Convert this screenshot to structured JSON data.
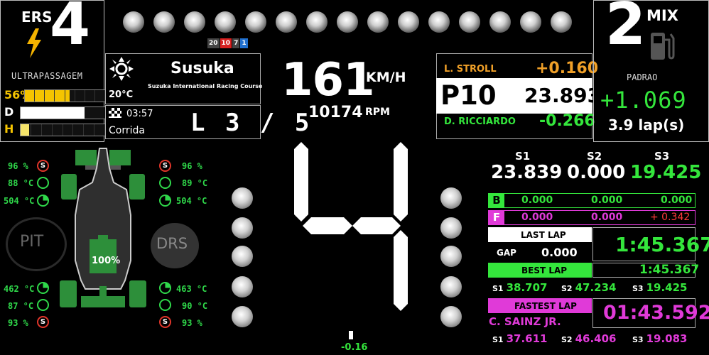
{
  "ers": {
    "label": "ERS",
    "mode": "4",
    "mode_name": "ULTRAPASSAGEM"
  },
  "bars": [
    {
      "label": "56%",
      "fill": 0.56,
      "color": "#f5c400",
      "label_color": "#f5c400"
    },
    {
      "label": "D",
      "fill": 0.76,
      "color": "#ffffff",
      "label_color": "#ffffff"
    },
    {
      "label": "H",
      "fill": 0.1,
      "color": "#f5e46a",
      "label_color": "#f5c400"
    }
  ],
  "track": {
    "name": "Susuka",
    "full_name": "Suzuka International Racing Course",
    "temp": "20°C",
    "session_time": "03:57",
    "session_type": "Corrida",
    "laps": "L 3 / 5"
  },
  "mini_lights": [
    "20",
    "10",
    "7",
    "1"
  ],
  "speed": {
    "value": "161",
    "unit": "KM/H"
  },
  "rpm": {
    "value": "10174",
    "unit": "RPM"
  },
  "position": {
    "ahead_name": "L. STROLL",
    "ahead_gap": "+0.160",
    "label": "P10",
    "time": "23.893",
    "behind_name": "D. RICCIARDO",
    "behind_gap": "-0.266"
  },
  "fuel": {
    "mode": "2",
    "label": "MIX",
    "mode_name": "PADRAO",
    "delta": "+1.069",
    "laps": "3.9 lap(s)"
  },
  "gear": "4",
  "tyres": {
    "fl": {
      "wear": "96 %",
      "temp": "88 °C",
      "brake": "504 °C"
    },
    "fr": {
      "wear": "96 %",
      "temp": "89 °C",
      "brake": "504 °C"
    },
    "rl": {
      "brake": "462 °C",
      "temp": "87 °C",
      "wear": "93 %"
    },
    "rr": {
      "brake": "463 °C",
      "temp": "90 °C",
      "wear": "93 %"
    }
  },
  "car": {
    "fuel_pct": "100%"
  },
  "pit": "PIT",
  "drs": "DRS",
  "sectors": {
    "heads": [
      "S1",
      "S2",
      "S3"
    ],
    "values": [
      "23.839",
      "0.000",
      "19.425"
    ]
  },
  "delta_rows": [
    {
      "key": "B",
      "values": [
        "0.000",
        "0.000",
        "0.000"
      ]
    },
    {
      "key": "F",
      "values": [
        "0.000",
        "0.000",
        "+ 0.342"
      ]
    }
  ],
  "last_lap": {
    "label": "LAST LAP",
    "time": "1:45.367",
    "gap_label": "GAP",
    "gap": "0.000"
  },
  "best_lap": {
    "label": "BEST LAP",
    "time": "1:45.367",
    "s1_label": "S1",
    "s1": "38.707",
    "s2_label": "S2",
    "s2": "47.234",
    "s3_label": "S3",
    "s3": "19.425"
  },
  "fastest_lap": {
    "label": "FASTEST LAP",
    "time": "01:43.592",
    "driver": "C. SAINZ JR.",
    "s1_label": "S1",
    "s1": "37.611",
    "s2_label": "S2",
    "s2": "46.406",
    "s3_label": "S3",
    "s3": "19.083"
  },
  "steering": {
    "value": "-0.16"
  }
}
